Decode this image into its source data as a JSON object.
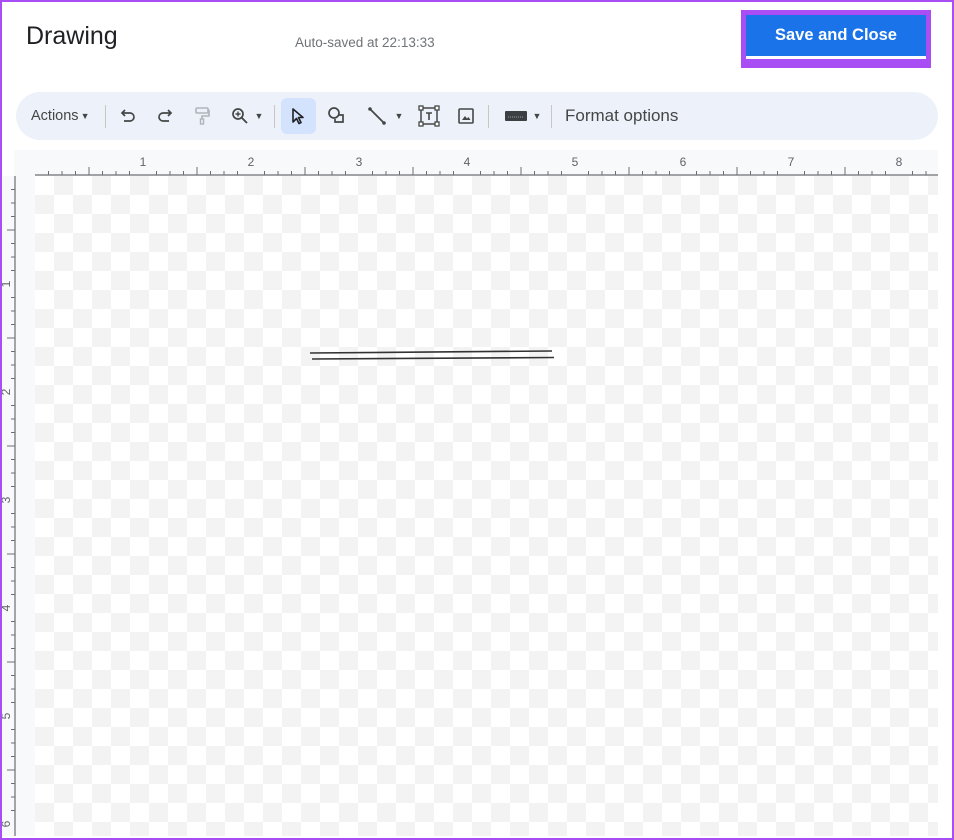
{
  "header": {
    "title": "Drawing",
    "autosave_status": "Auto-saved at 22:13:33",
    "save_close_label": "Save and Close"
  },
  "toolbar": {
    "actions_label": "Actions",
    "format_options_label": "Format options",
    "tools": [
      {
        "name": "undo-icon"
      },
      {
        "name": "redo-icon"
      },
      {
        "name": "paint-format-icon",
        "disabled": true
      },
      {
        "name": "zoom-icon",
        "has_dropdown": true
      },
      {
        "name": "select-icon",
        "active": true
      },
      {
        "name": "shape-icon"
      },
      {
        "name": "line-icon",
        "has_dropdown": true
      },
      {
        "name": "text-box-icon"
      },
      {
        "name": "image-icon"
      },
      {
        "name": "word-art-icon",
        "has_dropdown": true
      }
    ]
  },
  "rulers": {
    "horizontal_labels": [
      "1",
      "2",
      "3",
      "4",
      "5",
      "6",
      "7",
      "8"
    ],
    "vertical_labels": [
      "1",
      "2",
      "3",
      "4",
      "5",
      "6"
    ]
  },
  "colors": {
    "accent": "#1a73e8",
    "highlight_border": "#a94ef5",
    "toolbar_bg": "#edf2fa",
    "active_tool_bg": "#d3e3fd"
  }
}
